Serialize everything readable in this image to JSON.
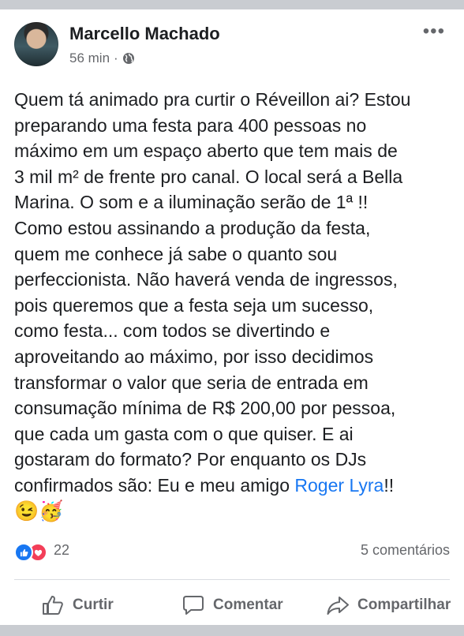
{
  "post": {
    "author": "Marcello Machado",
    "time": "56 min",
    "separator": "·",
    "audience_icon": "globe-icon",
    "more_icon": "more-options-icon",
    "text_lines": [
      "Quem tá animado pra curtir o Réveillon ai? Estou",
      "preparando uma festa para 400 pessoas no",
      "máximo em um espaço aberto que tem mais de",
      "3 mil m² de frente pro canal.  O local será a Bella",
      "Marina. O som e a iluminação serão de 1ª !!",
      "Como estou assinando a produção da festa,",
      "quem me conhece já sabe o quanto sou",
      "perfeccionista. Não haverá venda de ingressos,",
      "pois queremos que a festa seja um sucesso,",
      "como festa... com todos se divertindo e",
      "aproveitando ao máximo, por isso decidimos",
      "transformar o valor que seria de entrada em",
      "consumação mínima de R$ 200,00 por pessoa,",
      "que cada um gasta com o que quiser. E ai",
      "gostaram do formato? Por enquanto os DJs"
    ],
    "last_line_prefix": "confirmados são: Eu e meu amigo ",
    "mention": "Roger Lyra",
    "last_line_suffix": "!!",
    "emojis": "😉🥳"
  },
  "stats": {
    "reaction_icons": [
      "like-icon",
      "love-icon"
    ],
    "reaction_count": "22",
    "comments": "5 comentários"
  },
  "actions": {
    "like": "Curtir",
    "comment": "Comentar",
    "share": "Compartilhar"
  },
  "colors": {
    "accent": "#1877f2",
    "love": "#f33e58",
    "secondary_text": "#65676b",
    "background": "#c9ccd1"
  }
}
